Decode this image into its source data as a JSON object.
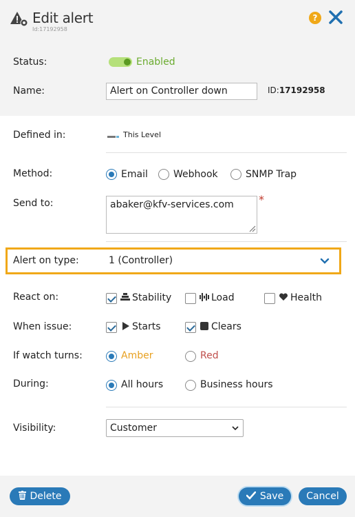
{
  "header": {
    "title": "Edit alert",
    "subtitle_id": "Id:17192958",
    "title_icon": "alert-gear-icon",
    "help_glyph": "?",
    "help_icon": "help-icon",
    "close_icon": "close-icon"
  },
  "status": {
    "label": "Status:",
    "toggle_state": "on",
    "toggle_text": "Enabled"
  },
  "name": {
    "label": "Name:",
    "value": "Alert on Controller down",
    "id_prefix": "ID:",
    "id_value": "17192958"
  },
  "defined_in": {
    "label": "Defined in:",
    "value": "This Level",
    "icon": "level-icon"
  },
  "method": {
    "label": "Method:",
    "options": [
      "Email",
      "Webhook",
      "SNMP Trap"
    ],
    "selected": "Email"
  },
  "send_to": {
    "label": "Send to:",
    "value": "abaker@kfv-services.com",
    "required_mark": "*"
  },
  "alert_on_type": {
    "label": "Alert on type:",
    "value": "1 (Controller)"
  },
  "react_on": {
    "label": "React on:",
    "options": [
      {
        "label": "Stability",
        "checked": true,
        "icon": "stability-icon"
      },
      {
        "label": "Load",
        "checked": false,
        "icon": "load-icon"
      },
      {
        "label": "Health",
        "checked": false,
        "icon": "heart-icon"
      }
    ]
  },
  "when_issue": {
    "label": "When issue:",
    "options": [
      {
        "label": "Starts",
        "checked": true,
        "icon": "play-icon"
      },
      {
        "label": "Clears",
        "checked": true,
        "icon": "square-icon"
      }
    ]
  },
  "watch_turns": {
    "label": "If watch turns:",
    "options": [
      {
        "label": "Amber",
        "color": "#e8a020"
      },
      {
        "label": "Red",
        "color": "#c0504d"
      }
    ],
    "selected": "Amber"
  },
  "during": {
    "label": "During:",
    "options": [
      "All hours",
      "Business hours"
    ],
    "selected": "All hours"
  },
  "visibility": {
    "label": "Visibility:",
    "value": "Customer"
  },
  "footer": {
    "delete_label": "Delete",
    "save_label": "Save",
    "cancel_label": "Cancel"
  },
  "colors": {
    "accent": "#2a7ab8",
    "highlight": "#f0a818",
    "enabled": "#6aab2e",
    "required": "#c0392b"
  }
}
